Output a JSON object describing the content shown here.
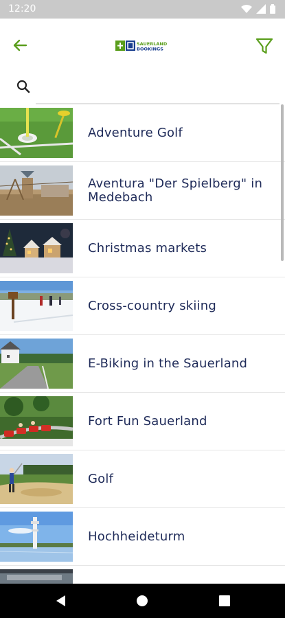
{
  "status_bar": {
    "time": "12:20"
  },
  "header": {
    "logo_text_top": "SAUERLAND",
    "logo_text_bottom": "BOOKINGS",
    "accent_color": "#5a9e1c",
    "logo_blue": "#1a3f8f"
  },
  "search": {
    "value": "",
    "placeholder": ""
  },
  "items": [
    {
      "label": "Adventure Golf",
      "thumb": "mini-golf"
    },
    {
      "label": "Aventura \"Der Spielberg\" in Medebach",
      "thumb": "playground"
    },
    {
      "label": "Christmas markets",
      "thumb": "christmas-market"
    },
    {
      "label": "Cross-country skiing",
      "thumb": "skiing"
    },
    {
      "label": "E-Biking in the Sauerland",
      "thumb": "country-road"
    },
    {
      "label": "Fort Fun Sauerland",
      "thumb": "coaster"
    },
    {
      "label": "Golf",
      "thumb": "golfer"
    },
    {
      "label": "Hochheideturm",
      "thumb": "tower"
    }
  ],
  "colors": {
    "item_text": "#1f2b59",
    "status_bar": "#c9c9c9",
    "nav_bar": "#000000"
  },
  "nav": {
    "back": "back-nav-icon",
    "home": "home-nav-icon",
    "recents": "recents-nav-icon"
  }
}
